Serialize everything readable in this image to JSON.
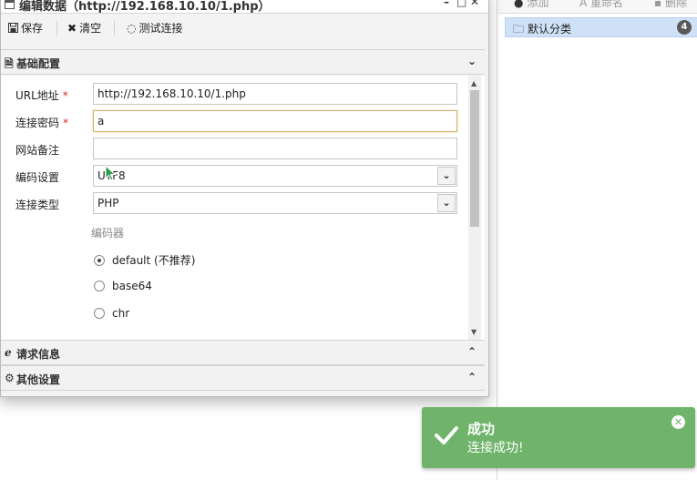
{
  "dialog": {
    "title": "编辑数据（http://192.168.10.10/1.php）",
    "controls": {
      "minimize": "–",
      "maximize": "□",
      "close": "✕"
    }
  },
  "toolbar": {
    "save_label": "保存",
    "clear_label": "清空",
    "test_label": "测试连接"
  },
  "sections": {
    "basic": {
      "title": "基础配置",
      "expanded": true
    },
    "request": {
      "title": "请求信息",
      "expanded": false
    },
    "other": {
      "title": "其他设置",
      "expanded": false
    }
  },
  "form": {
    "url": {
      "label": "URL地址",
      "required_mark": "*",
      "value": "http://192.168.10.10/1.php"
    },
    "password": {
      "label": "连接密码",
      "required_mark": "*",
      "value": "a"
    },
    "remark": {
      "label": "网站备注",
      "value": ""
    },
    "encoding": {
      "label": "编码设置",
      "value": "UTF8"
    },
    "conn_type": {
      "label": "连接类型",
      "value": "PHP"
    },
    "encoder": {
      "label": "编码器",
      "options": [
        {
          "label": "default (不推荐)",
          "checked": true
        },
        {
          "label": "base64",
          "checked": false
        },
        {
          "label": "chr",
          "checked": false
        }
      ]
    }
  },
  "right_panel": {
    "toolbar": {
      "add": "添加",
      "rename": "重命名",
      "delete": "删除"
    },
    "category": {
      "label": "默认分类",
      "count": "4"
    }
  },
  "toast": {
    "title": "成功",
    "message": "连接成功!",
    "color": "#6fb46a"
  }
}
